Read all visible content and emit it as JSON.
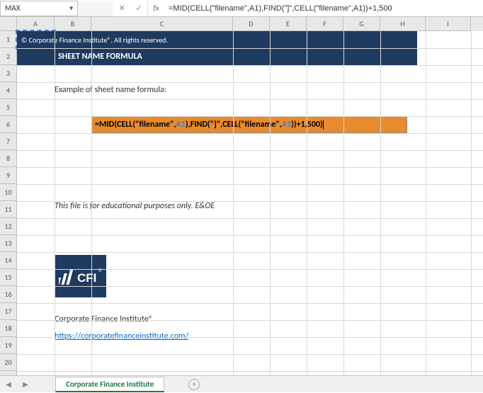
{
  "name_box": "MAX",
  "formula_bar": "=MID(CELL(\"filename\",A1),FIND(\"]\",CELL(\"filename\",A1))+1,500",
  "columns": [
    "A",
    "B",
    "C",
    "D",
    "E",
    "F",
    "G",
    "H",
    "I"
  ],
  "row_count": 21,
  "banner": {
    "copyright": "© Corporate Finance Institute®. All rights reserved.",
    "title": "SHEET NAME FORMULA"
  },
  "example_label": "Example of sheet name formula:",
  "formula_parts": {
    "eq": "=",
    "mid": "MID",
    "cell": "CELL",
    "find": "FIND",
    "lp": "(",
    "rp": ")",
    "comma": ",",
    "str_filename": "\"filename\"",
    "str_bracket": "\"]\"",
    "ref_a1": "A1",
    "plus": "+",
    "num_1": "1",
    "num_500": "500"
  },
  "note": "This file is for educational purposes only. E&OE",
  "logo_text": "CFI",
  "company": "Corporate Finance Institute®",
  "url": "https://corporatefinanceinstitute.com/",
  "sheet_tab": "Corporate Finance Institute",
  "fx_symbol": "fx"
}
